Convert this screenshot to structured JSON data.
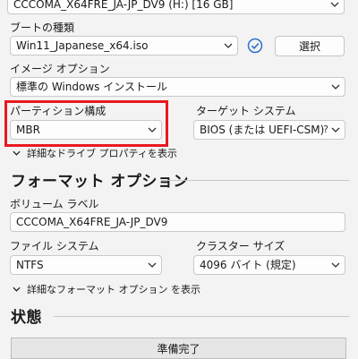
{
  "device": {
    "value": "CCCOMA_X64FRE_JA-JP_DV9 (H:) [16 GB]"
  },
  "boot_type": {
    "label": "ブートの種類",
    "value": "Win11_Japanese_x64.iso",
    "select_button": "選択"
  },
  "image_option": {
    "label": "イメージ オプション",
    "value": "標準の Windows インストール"
  },
  "partition_scheme": {
    "label": "パーティション構成",
    "value": "MBR"
  },
  "target_system": {
    "label": "ターゲット システム",
    "value": "BIOS (または UEFI-CSM)",
    "help": "?"
  },
  "advanced_drive": {
    "label": "詳細なドライブ プロパティを表示"
  },
  "format_section": {
    "title": "フォーマット オプション"
  },
  "volume_label": {
    "label": "ボリューム ラベル",
    "value": "CCCOMA_X64FRE_JA-JP_DV9"
  },
  "file_system": {
    "label": "ファイル システム",
    "value": "NTFS"
  },
  "cluster_size": {
    "label": "クラスター サイズ",
    "value": "4096 バイト (規定)"
  },
  "advanced_format": {
    "label": "詳細なフォーマット オプション を表示"
  },
  "status_section": {
    "title": "状態",
    "status_text": "準備完了"
  },
  "colors": {
    "highlight": "#e8191f",
    "check_icon": "#2f6fd0"
  }
}
